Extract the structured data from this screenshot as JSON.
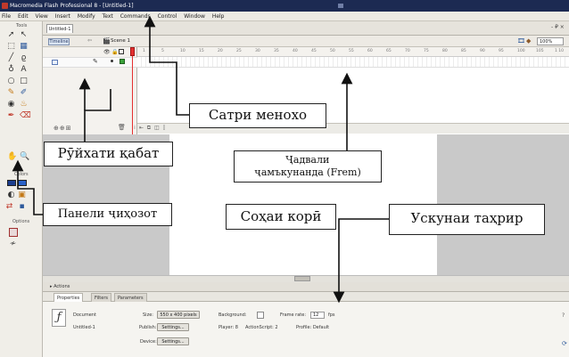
{
  "window": {
    "title": "Macromedia Flash Professional 8 - [Untitled-1]"
  },
  "menu": {
    "items": [
      "File",
      "Edit",
      "View",
      "Insert",
      "Modify",
      "Text",
      "Commands",
      "Control",
      "Window",
      "Help"
    ]
  },
  "tools_panel": {
    "title": "Tools",
    "section_colors": "Colors",
    "section_options": "Options"
  },
  "document": {
    "tab": "Untitled-1",
    "close": "- ₽ ×",
    "timeline_button": "Timeline",
    "scene_label": "Scene 1",
    "zoom": "100%"
  },
  "timeline": {
    "ruler_ticks": [
      "1",
      "5",
      "10",
      "15",
      "20",
      "25",
      "30",
      "35",
      "40",
      "45",
      "50",
      "55",
      "60",
      "65",
      "70",
      "75",
      "80",
      "85",
      "90",
      "95",
      "100",
      "105",
      "1 10"
    ]
  },
  "panels": {
    "actions_label": "▸ Actions",
    "tabs": [
      "Properties",
      "Filters",
      "Parameters"
    ],
    "properties": {
      "document_label": "Document",
      "document_name": "Untitled-1",
      "size_label": "Size:",
      "size_value": "550 x 400 pixels",
      "background_label": "Background:",
      "frame_rate_label": "Frame rate:",
      "frame_rate_value": "12",
      "fps_label": "fps",
      "publish_label": "Publish:",
      "settings_button": "Settings...",
      "player_label": "Player: 8",
      "actionscript_label": "ActionScript: 2",
      "profile_label": "Profile: Default",
      "device_label": "Device:",
      "device_settings_button": "Settings..."
    }
  },
  "callouts": {
    "menu_bar": "Сатри менохо",
    "layer_list": "Рӯйхати қабат",
    "frames_line1": "Ҷадвали",
    "frames_line2": "ҷамъкунанда (Frem)",
    "tools_panel": "Панели ҷиҳозот",
    "stage": "Соҳаи корӣ",
    "edit_bar": "Ускунаи таҳрир"
  },
  "colors": {
    "titlebar": "#1c2a52",
    "playhead": "#e53030",
    "stage": "#ffffff",
    "pasteboard": "#c9c9c9",
    "layer_color": "#3aa23a"
  }
}
